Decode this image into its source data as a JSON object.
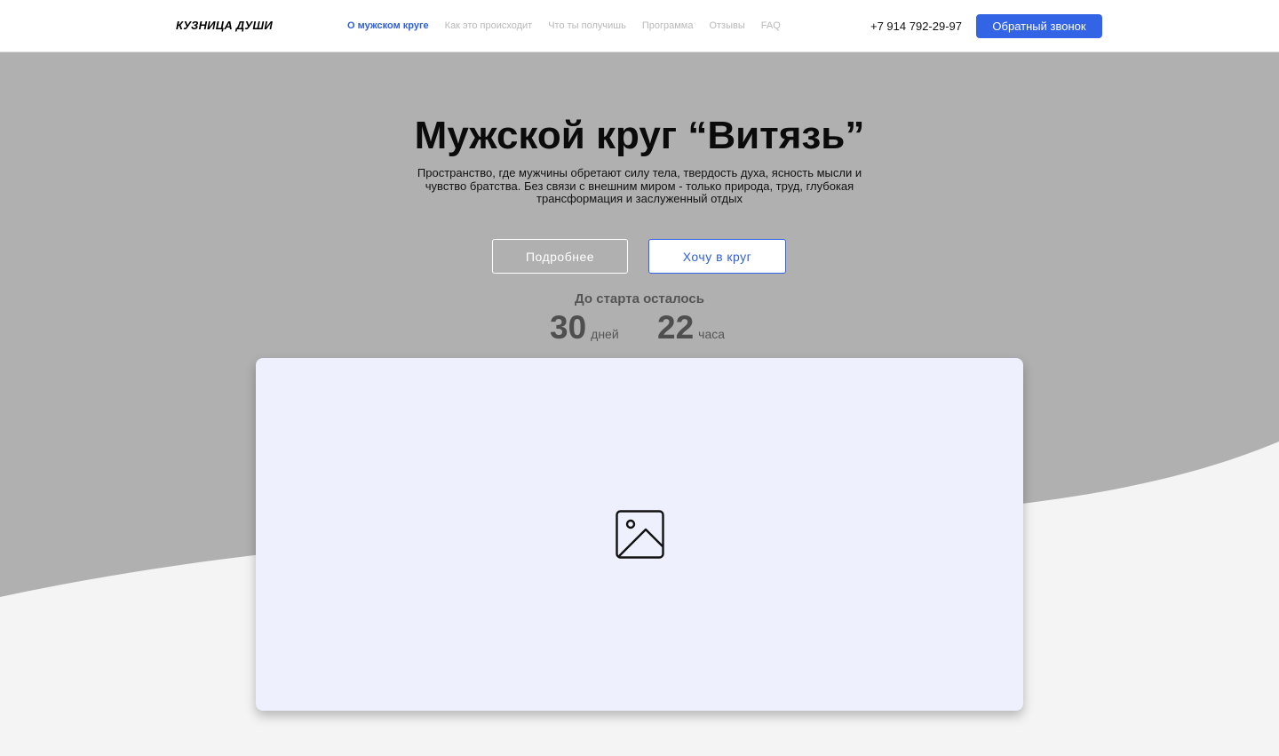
{
  "header": {
    "logo": "КУЗНИЦА ДУШИ",
    "nav": [
      {
        "label": "О мужском круге",
        "active": true
      },
      {
        "label": "Как это происходит",
        "active": false
      },
      {
        "label": "Что ты получишь",
        "active": false
      },
      {
        "label": "Программа",
        "active": false
      },
      {
        "label": "Отзывы",
        "active": false
      },
      {
        "label": "FAQ",
        "active": false
      }
    ],
    "phone": "+7 914 792-29-97",
    "callback_label": "Обратный звонок"
  },
  "hero": {
    "title": "Мужской круг “Витязь”",
    "subtitle": "Пространство, где мужчины обретают силу тела, твердость духа, ясность мысли и чувство братства. Без связи с внешним миром - только природа, труд, глубокая трансформация и заслуженный отдых",
    "more_label": "Подробнее",
    "join_label": "Хочу в круг",
    "countdown": {
      "label": "До старта осталось",
      "days_value": "30",
      "days_unit": "дней",
      "hours_value": "22",
      "hours_unit": "часа"
    },
    "media_icon": "image-placeholder-icon"
  },
  "colors": {
    "accent": "#3364e6",
    "hero_gray": "#b0b0b0",
    "page_bg": "#f4f4f4",
    "card_bg": "#eef1fd"
  }
}
